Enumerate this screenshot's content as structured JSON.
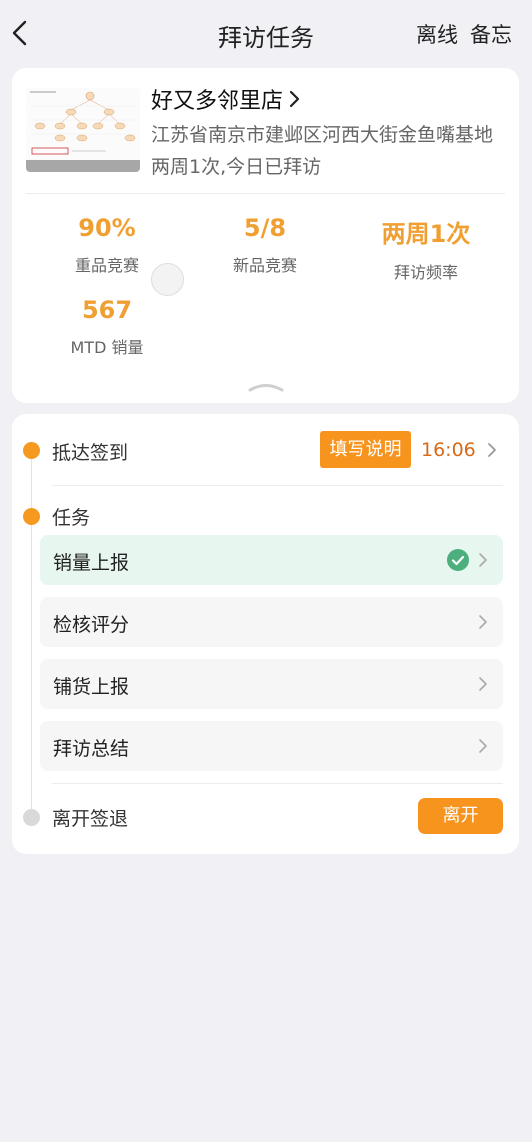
{
  "header": {
    "title": "拜访任务",
    "offline_label": "离线",
    "memo_label": "备忘"
  },
  "store": {
    "name": "好又多邻里店",
    "address": "江苏省南京市建邺区河西大街金鱼嘴基地",
    "visit_frequency_text": "两周1次,今日已拜访"
  },
  "stats": [
    {
      "value": "90%",
      "label": "重品竞赛"
    },
    {
      "value": "5/8",
      "label": "新品竞赛"
    },
    {
      "value": "两周1次",
      "label": "拜访频率"
    },
    {
      "value": "567",
      "label": "MTD 销量"
    }
  ],
  "tasks": {
    "checkin_label": "抵达签到",
    "fill_note_label": "填写说明",
    "checkin_time": "16:06",
    "task_section_label": "任务",
    "items": [
      {
        "label": "销量上报",
        "done": true
      },
      {
        "label": "检核评分",
        "done": false
      },
      {
        "label": "铺货上报",
        "done": false
      },
      {
        "label": "拜访总结",
        "done": false
      }
    ],
    "checkout_label": "离开签退",
    "leave_label": "离开"
  },
  "colors": {
    "accent": "#f7941d",
    "stat_value": "#f0a033",
    "done_bg": "#e7f6ef",
    "check": "#4caf7d"
  }
}
